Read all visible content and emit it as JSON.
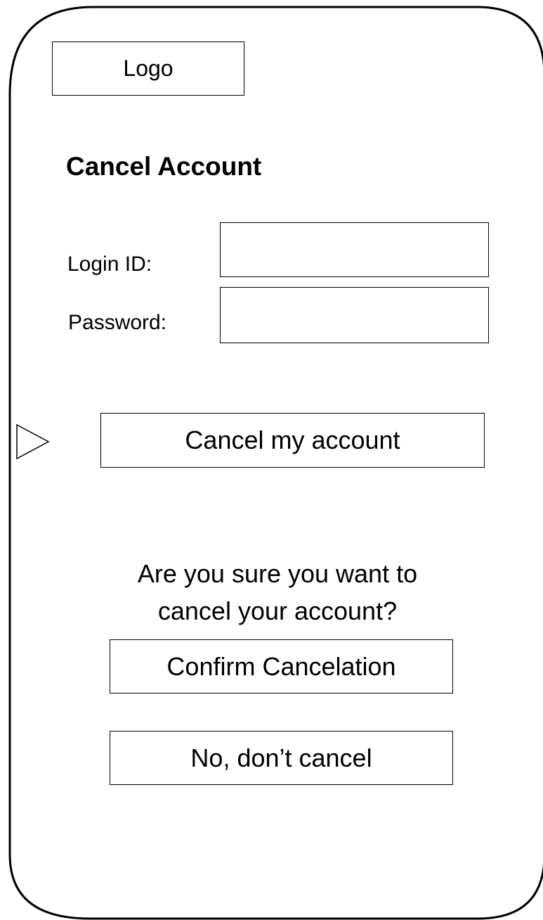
{
  "app": {
    "logo_label": "Logo"
  },
  "page": {
    "title": "Cancel Account"
  },
  "form": {
    "login_label": "Login ID:",
    "login_value": "",
    "password_label": "Password:",
    "password_value": "",
    "cancel_button_label": "Cancel my account"
  },
  "confirm": {
    "question": "Are you sure you want to cancel your account?",
    "confirm_button_label": "Confirm Cancelation",
    "no_button_label": "No, don’t cancel"
  },
  "icons": {
    "pointer": "play-triangle-icon"
  },
  "colors": {
    "line": "#000000",
    "background": "#ffffff"
  }
}
